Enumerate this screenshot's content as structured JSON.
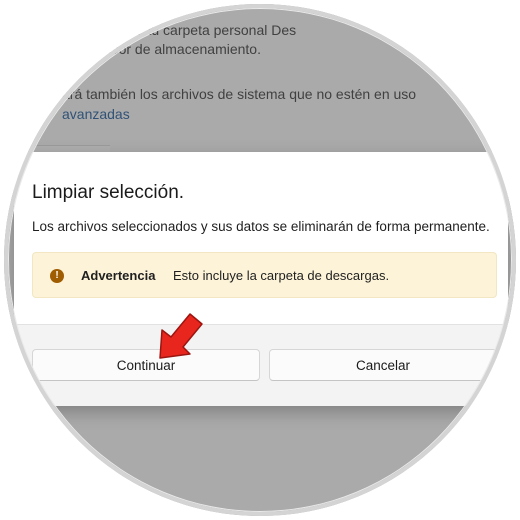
{
  "background": {
    "line1": "archivos de tu carpeta personal Des",
    "line2": "ensor de almacenamiento.",
    "line3": "ará también los archivos de sistema que no estén en uso",
    "link": "avanzadas"
  },
  "dialog": {
    "title": "Limpiar selección.",
    "message": "Los archivos seleccionados y sus datos se eliminarán de forma permanente.",
    "warning": {
      "icon": "warning-icon",
      "title": "Advertencia",
      "text": "Esto incluye la carpeta de descargas."
    },
    "buttons": {
      "continue_label": "Continuar",
      "cancel_label": "Cancelar"
    }
  },
  "annotation": {
    "icon": "red-arrow-pointer",
    "color": "#e8261e"
  },
  "colors": {
    "warning_bg": "#fcf3d8",
    "warning_icon": "#a05c00",
    "link": "#0e4a8c"
  }
}
